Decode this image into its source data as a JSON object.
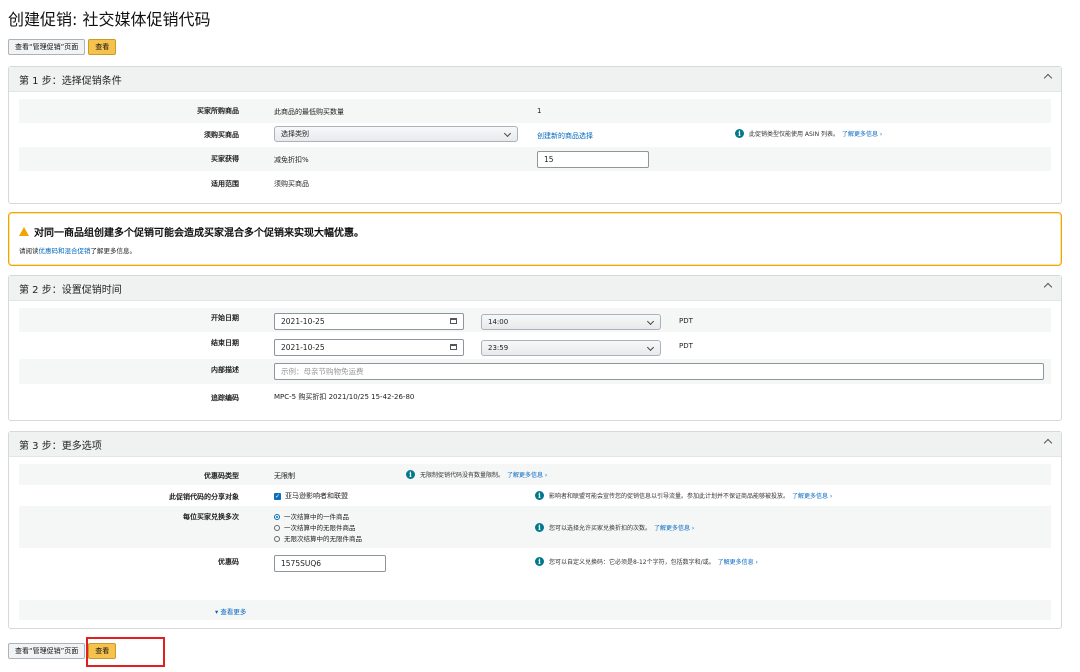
{
  "page": {
    "title": "创建促销: 社交媒体促销代码"
  },
  "top_buttons": {
    "view_manage": "查看“管理促销”页面",
    "view": "查看"
  },
  "step1": {
    "title": "第 1 步：选择促销条件",
    "rows": [
      {
        "label": "买家所购商品",
        "value": "此商品的最低购买数量",
        "value2": "1"
      },
      {
        "label": "须购买商品",
        "select": "选择类别",
        "link": "创建新的商品选择",
        "note": "此促销类型仅能使用 ASIN 列表。",
        "note_link": "了解更多信息 ›"
      },
      {
        "label": "买家获得",
        "value": "减免折扣%",
        "input": "15"
      },
      {
        "label": "适用范围",
        "value": "须购买商品"
      }
    ]
  },
  "warning": {
    "title": "对同一商品组创建多个促销可能会造成买家混合多个促销来实现大幅优惠。",
    "text_before": "请阅读",
    "text_link": "优惠码和混合促销",
    "text_after": "了解更多信息。"
  },
  "step2": {
    "title": "第 2 步：设置促销时间",
    "start": {
      "label": "开始日期",
      "date": "2021-10-25",
      "time": "14:00",
      "tz": "PDT"
    },
    "end": {
      "label": "结束日期",
      "date": "2021-10-25",
      "time": "23:59",
      "tz": "PDT"
    },
    "desc": {
      "label": "内部描述",
      "placeholder": "示例：母亲节购物免运费"
    },
    "tracking": {
      "label": "追踪编码",
      "value": "MPC-5 购买折扣 2021/10/25 15-42-26-80"
    }
  },
  "step3": {
    "title": "第 3 步：更多选项",
    "code_type": {
      "label": "优惠码类型",
      "value": "无限制",
      "note": "无限制促销代码没有数量限制。",
      "note_link": "了解更多信息 ›"
    },
    "share": {
      "label": "此促销代码的分享对象",
      "value": "亚马逊影响者和联盟",
      "note": "影响者和联盟可能会宣传您的促销信息以引导流量。参加此计划并不保证商品能够被投放。",
      "note_link": "了解更多信息 ›"
    },
    "redeem": {
      "label": "每位买家兑换多次",
      "options": [
        "一次结算中的一件商品",
        "一次结算中的无限件商品",
        "无限次结算中的无限件商品"
      ],
      "note": "您可以选择允许买家兑换折扣的次数。",
      "note_link": "了解更多信息 ›"
    },
    "coupon": {
      "label": "优惠码",
      "value": "1575SUQ6",
      "note": "您可以自定义兑换码：它必须是8-12个字符，包括数字和/或。",
      "note_link": "了解更多信息 ›"
    },
    "more_link": "▾ 查看更多"
  },
  "bottom_buttons": {
    "view_manage": "查看“管理促销”页面",
    "view": "查看"
  },
  "icons": {
    "collapse": "chevron-up-icon",
    "info": "info-icon",
    "warning": "warning-icon",
    "calendar": "calendar-icon",
    "dropdown": "chevron-down-icon"
  }
}
